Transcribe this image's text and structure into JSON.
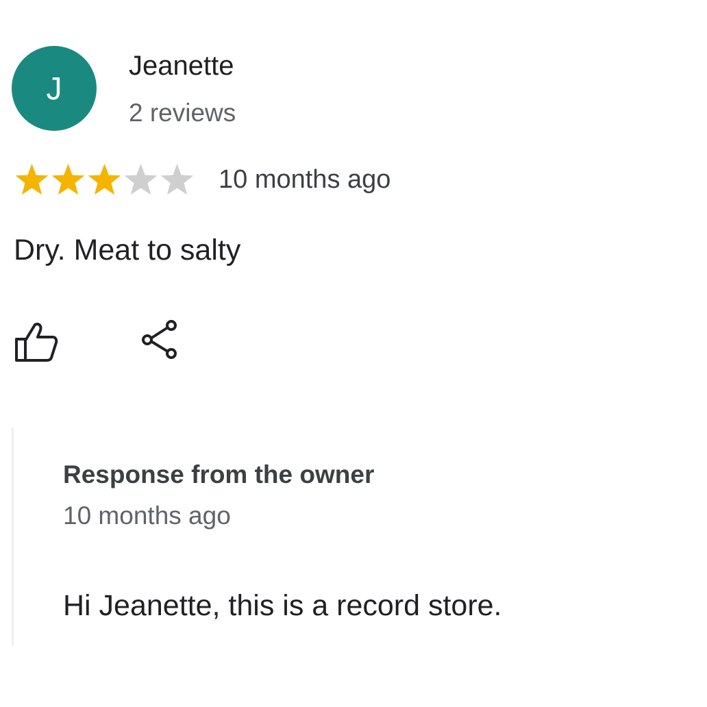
{
  "review": {
    "avatar_initial": "J",
    "avatar_color": "#1a8a80",
    "reviewer_name": "Jeanette",
    "reviewer_meta": "2 reviews",
    "rating": 3,
    "rating_max": 5,
    "star_filled_color": "#f4b400",
    "star_empty_color": "#cfcfcf",
    "date": "10 months ago",
    "text": "Dry. Meat to salty",
    "actions": [
      {
        "name": "like",
        "icon": "thumbs-up-icon"
      },
      {
        "name": "share",
        "icon": "share-icon"
      }
    ]
  },
  "owner_response": {
    "title": "Response from the owner",
    "date": "10 months ago",
    "text": "Hi Jeanette, this is a record store."
  }
}
